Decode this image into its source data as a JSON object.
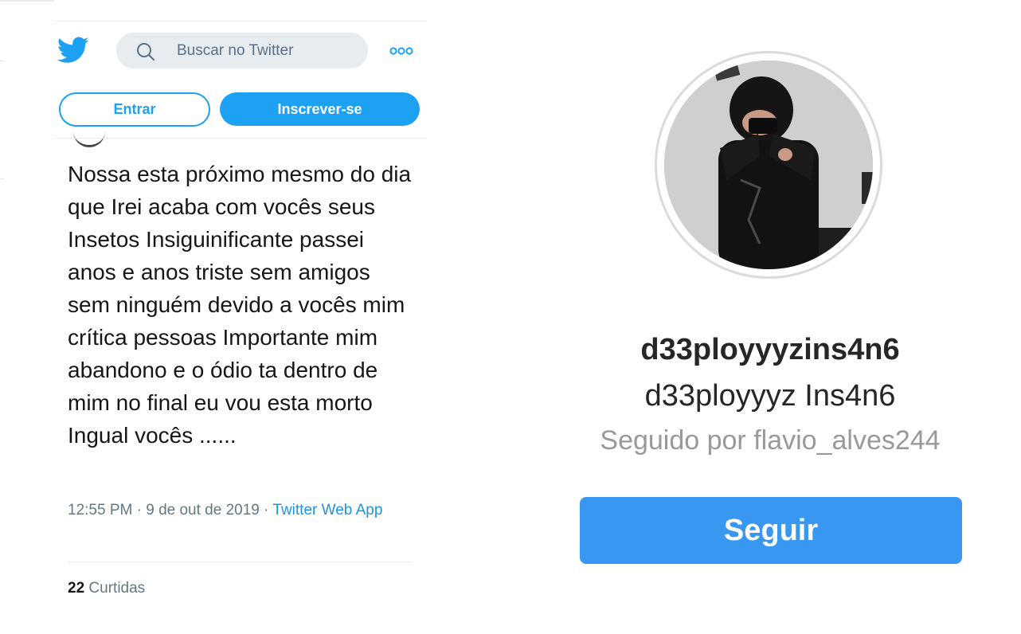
{
  "twitter": {
    "search": {
      "placeholder": "Buscar no Twitter"
    },
    "buttons": {
      "login": "Entrar",
      "signup": "Inscrever-se"
    },
    "tweet": {
      "text": "Nossa esta próximo mesmo do dia que Irei acaba com vocês seus Insetos Insiguinificante passei anos e anos triste sem amigos sem ninguém devido a vocês mim crítica pessoas Importante mim abandono e o ódio ta dentro de mim no final eu vou esta morto Ingual vocês ......",
      "time": "12:55 PM",
      "date": "9 de out de 2019",
      "source": "Twitter Web App",
      "likes_count": "22",
      "likes_label": "Curtidas"
    },
    "colors": {
      "accent": "#1da1f2",
      "search_bg": "#e6ecf0",
      "muted": "#657786"
    },
    "icons": {
      "logo": "twitter-bird-icon",
      "search": "search-icon",
      "more": "more-options-icon"
    }
  },
  "instagram": {
    "profile": {
      "username": "d33ployyyzins4n6",
      "full_name": "d33ployyyz Ins4n6",
      "followed_by": "Seguido por flavio_alves244"
    },
    "buttons": {
      "follow": "Seguir"
    },
    "colors": {
      "follow_button": "#3897f0",
      "secondary_text": "#999999"
    }
  }
}
